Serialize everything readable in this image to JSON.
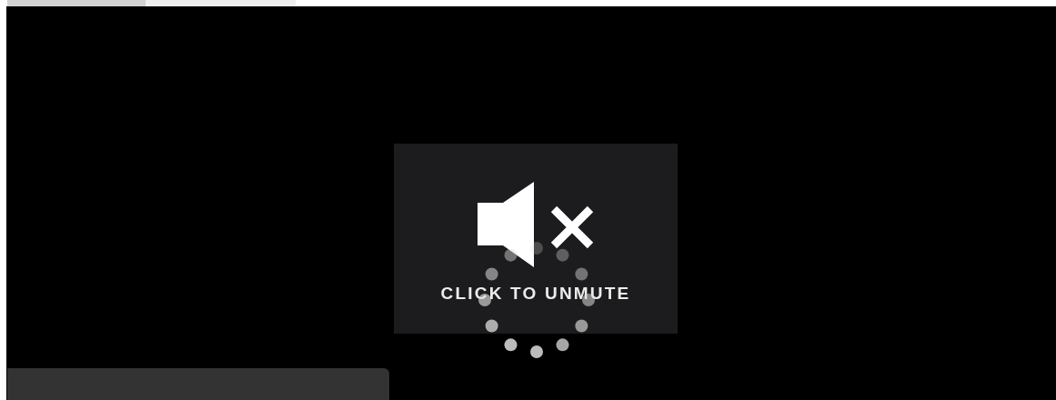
{
  "unmute_overlay": {
    "label": "CLICK TO UNMUTE"
  }
}
